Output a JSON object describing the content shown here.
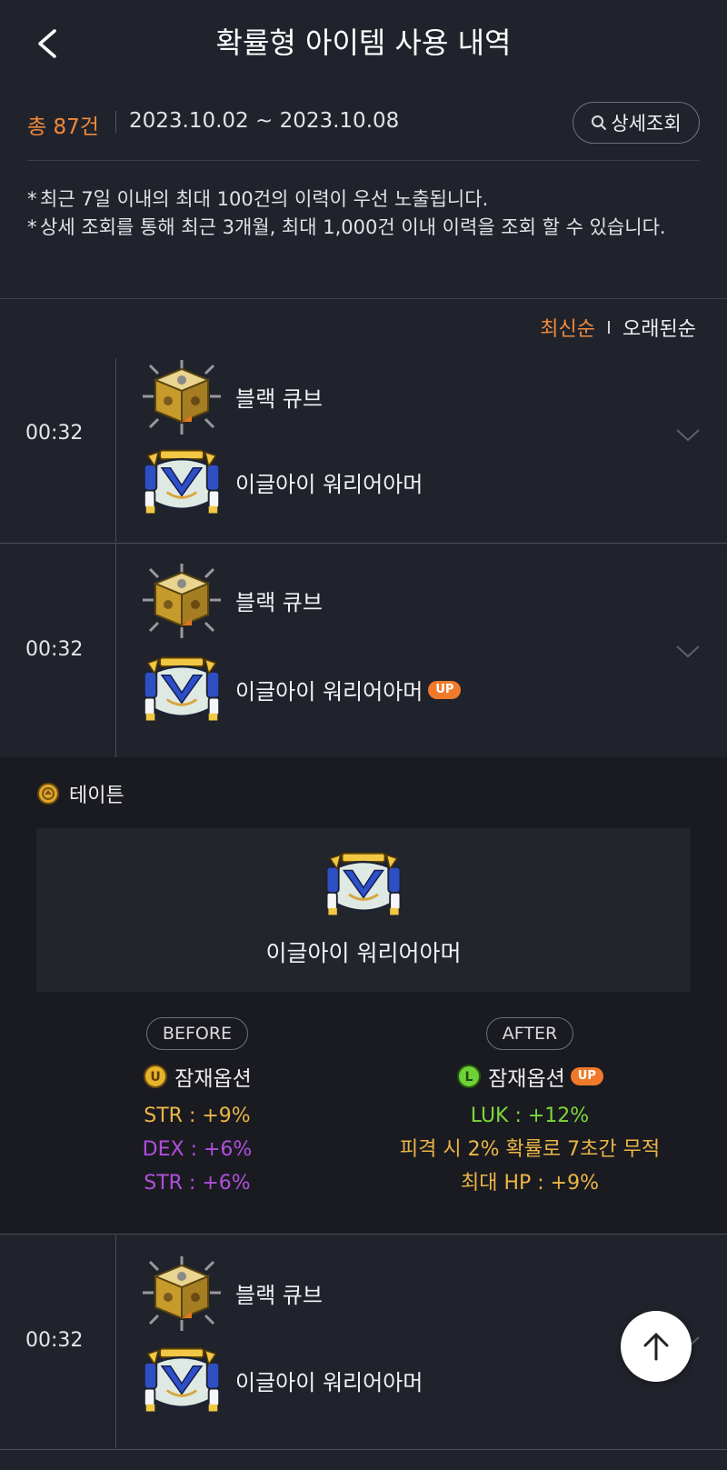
{
  "header": {
    "title": "확률형 아이템 사용 내역"
  },
  "summary": {
    "total": "총 87건",
    "date_range": "2023.10.02 ~ 2023.10.08",
    "detail_button": "상세조회"
  },
  "notes": [
    {
      "mark": "*",
      "text": "최근 7일 이내의 최대 100건의 이력이 우선 노출됩니다."
    },
    {
      "mark": "*",
      "text": "상세 조회를 통해 최근 3개월, 최대 1,000건 이내 이력을 조회 할 수 있습니다."
    }
  ],
  "sort": {
    "latest": "최신순",
    "oldest": "오래된순"
  },
  "history": [
    {
      "time": "00:32",
      "item1": "블랙 큐브",
      "item2": "이글아이 워리어아머"
    },
    {
      "time": "00:32",
      "item1": "블랙 큐브",
      "item2": "이글아이 워리어아머",
      "badge": "UP"
    },
    {
      "time": "00:32",
      "item1": "블랙 큐브",
      "item2": "이글아이 워리어아머"
    }
  ],
  "expanded": {
    "character": "테이튼",
    "item_name": "이글아이 워리어아머",
    "before": {
      "label": "BEFORE",
      "grade_icon": "U",
      "potential_label": "잠재옵션",
      "options": [
        "STR : +9%",
        "DEX : +6%",
        "STR : +6%"
      ]
    },
    "after": {
      "label": "AFTER",
      "grade_icon": "L",
      "potential_label": "잠재옵션",
      "badge": "UP",
      "options": [
        "LUK : +12%",
        "피격 시 2% 확률로 7초간 무적",
        "최대 HP : +9%"
      ]
    }
  },
  "colors": {
    "accent_orange": "#ef8a3c",
    "option_yellow": "#ebb646",
    "option_purple": "#b04fdc",
    "option_green": "#7ed63c"
  }
}
